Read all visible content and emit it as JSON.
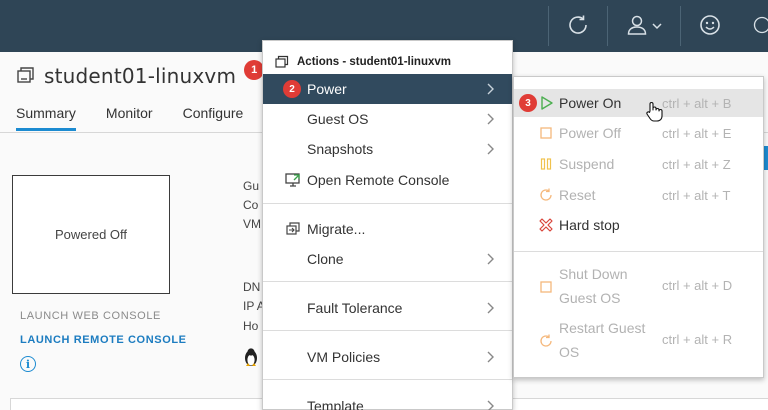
{
  "vm": {
    "name": "student01-linuxvm",
    "badge": "1"
  },
  "tabs": [
    {
      "label": "Summary"
    },
    {
      "label": "Monitor"
    },
    {
      "label": "Configure"
    }
  ],
  "console": {
    "state": "Powered Off",
    "launch_web": "LAUNCH WEB CONSOLE",
    "launch_remote": "LAUNCH REMOTE CONSOLE"
  },
  "side_fragments": [
    "Gu",
    "Co",
    "VM",
    "DN",
    "IP A",
    "Ho"
  ],
  "menu": {
    "title": "Actions - student01-linuxvm",
    "items": [
      {
        "label": "Power",
        "badge": "2",
        "submenu": true
      },
      {
        "label": "Guest OS",
        "submenu": true
      },
      {
        "label": "Snapshots",
        "submenu": true
      },
      {
        "label": "Open Remote Console"
      },
      {
        "label": "Migrate..."
      },
      {
        "label": "Clone",
        "submenu": true
      },
      {
        "label": "Fault Tolerance",
        "submenu": true
      },
      {
        "label": "VM Policies",
        "submenu": true
      },
      {
        "label": "Template",
        "submenu": true
      }
    ]
  },
  "power_menu": {
    "items": [
      {
        "label": "Power On",
        "shortcut": "ctrl + alt + B",
        "enabled": true,
        "badge": "3",
        "icon": "play-icon"
      },
      {
        "label": "Power Off",
        "shortcut": "ctrl + alt + E",
        "enabled": false,
        "icon": "stop-square-icon"
      },
      {
        "label": "Suspend",
        "shortcut": "ctrl + alt + Z",
        "enabled": false,
        "icon": "pause-icon"
      },
      {
        "label": "Reset",
        "shortcut": "ctrl + alt + T",
        "enabled": false,
        "icon": "reset-icon"
      },
      {
        "label": "Hard stop",
        "shortcut": "",
        "enabled": true,
        "icon": "hard-stop-icon"
      },
      {
        "label_line1": "Shut Down",
        "label_line2": "Guest OS",
        "shortcut": "ctrl + alt + D",
        "enabled": false,
        "icon": "shutdown-icon"
      },
      {
        "label_line1": "Restart Guest",
        "label_line2": "OS",
        "shortcut": "ctrl + alt + R",
        "enabled": false,
        "icon": "restart-icon"
      }
    ]
  },
  "colors": {
    "header": "#2f4556",
    "menu_active": "#314a5e",
    "accent_blue": "#1c8bd1",
    "badge_red": "#e03c36",
    "power_on_green": "#4caf50",
    "hard_stop_red": "#d9453b",
    "disabled_orange": "#f5b87c"
  }
}
